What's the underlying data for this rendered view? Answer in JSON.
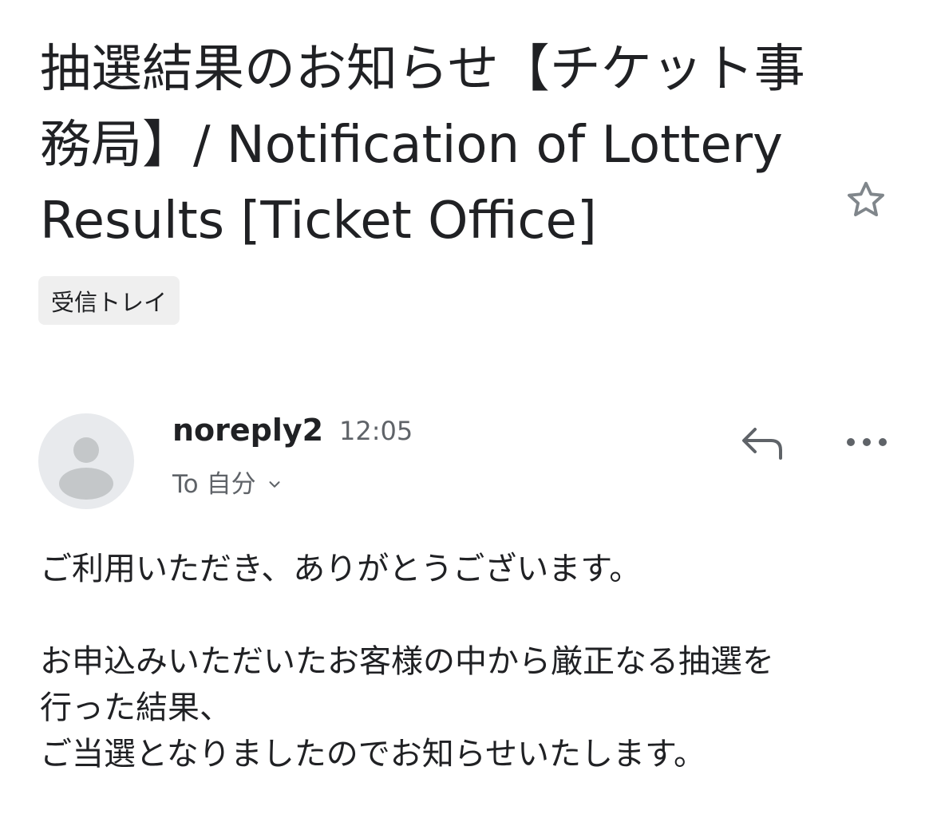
{
  "email": {
    "subject": "抽選結果のお知らせ【チケット事務局】/ Notification of Lottery Results [Ticket Office]",
    "label": "受信トレイ",
    "sender": "noreply2",
    "time": "12:05",
    "recipient_prefix": "To",
    "recipient": "自分",
    "body": {
      "line1": "ご利用いただき、ありがとうございます。",
      "line2": "お申込みいただいたお客様の中から厳正なる抽選を",
      "line3": "行った結果、",
      "line4": "ご当選となりましたのでお知らせいたします。"
    }
  },
  "icons": {
    "star": "star-outline-icon",
    "reply": "reply-icon",
    "more": "more-horizontal-icon",
    "avatar": "default-avatar-icon",
    "chevron": "chevron-down-icon"
  },
  "colors": {
    "text_primary": "#202124",
    "text_secondary": "#5f6368",
    "chip_bg": "#efefef",
    "avatar_bg": "#e8eaed",
    "avatar_fg": "#c4c7c9",
    "icon": "#5f6368"
  }
}
